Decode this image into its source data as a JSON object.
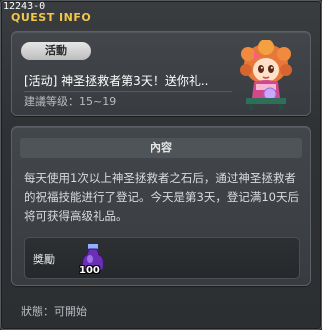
{
  "window": {
    "quest_id": "12243-0",
    "title": "QUEST INFO"
  },
  "quest": {
    "badge": "活動",
    "name": "[活动] 神圣拯救者第3天！送你礼..",
    "level_text": "建議等级：15~19"
  },
  "content": {
    "header": "內容",
    "description": "每天使用1次以上神圣拯救者之石后，通过神圣拯救者的祝福技能进行了登记。今天是第3天，登记满10天后将可获得高级礼品。"
  },
  "reward": {
    "label": "獎勵",
    "item_icon": "potion-bottle-icon",
    "quantity": "100"
  },
  "status_text": "狀態：可開始",
  "colors": {
    "title": "#f3c64a",
    "background": "#2b2e31"
  }
}
